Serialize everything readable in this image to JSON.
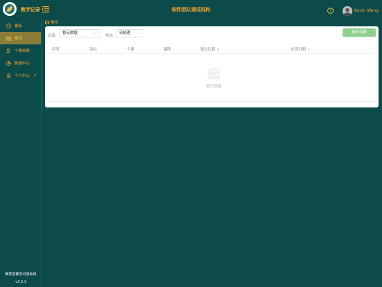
{
  "header": {
    "app_title": "教学记录",
    "org_title": "软件团队测试机构",
    "user_name": "Kevin Wang",
    "help_glyph": "?"
  },
  "sidebar": {
    "items": [
      {
        "label": "看板",
        "icon": "dashboard-icon"
      },
      {
        "label": "推待",
        "icon": "mail-icon"
      },
      {
        "label": "个案档案",
        "icon": "user-file-icon"
      },
      {
        "label": "数据中心",
        "icon": "data-icon"
      },
      {
        "label": "个人中心",
        "icon": "person-icon",
        "chevron": "▾"
      }
    ],
    "active_index": 1,
    "footer_name": "微笑爱教学记录系统",
    "footer_version": "v3.3.1"
  },
  "breadcrumb": {
    "label": "推待"
  },
  "filters": {
    "class_label": "班级:",
    "class_value": "暂无数据",
    "status_label": "状态:",
    "status_value": "待处理",
    "arrow": "⌄"
  },
  "actions": {
    "primary_label": "推待试算"
  },
  "table": {
    "columns": [
      {
        "label": "序号",
        "sortable": false
      },
      {
        "label": "目标",
        "sortable": false
      },
      {
        "label": "个案",
        "sortable": false
      },
      {
        "label": "课程",
        "sortable": false
      },
      {
        "label": "通过日期",
        "sortable": true
      },
      {
        "label": "处理日期",
        "sortable": true
      }
    ],
    "sort_glyph": "⬍",
    "empty_text": "暂无数据"
  },
  "colors": {
    "background": "#0d4a4a",
    "accent": "#f2a531",
    "active_nav": "#8a7d3a",
    "primary_button": "#8fd18a"
  }
}
